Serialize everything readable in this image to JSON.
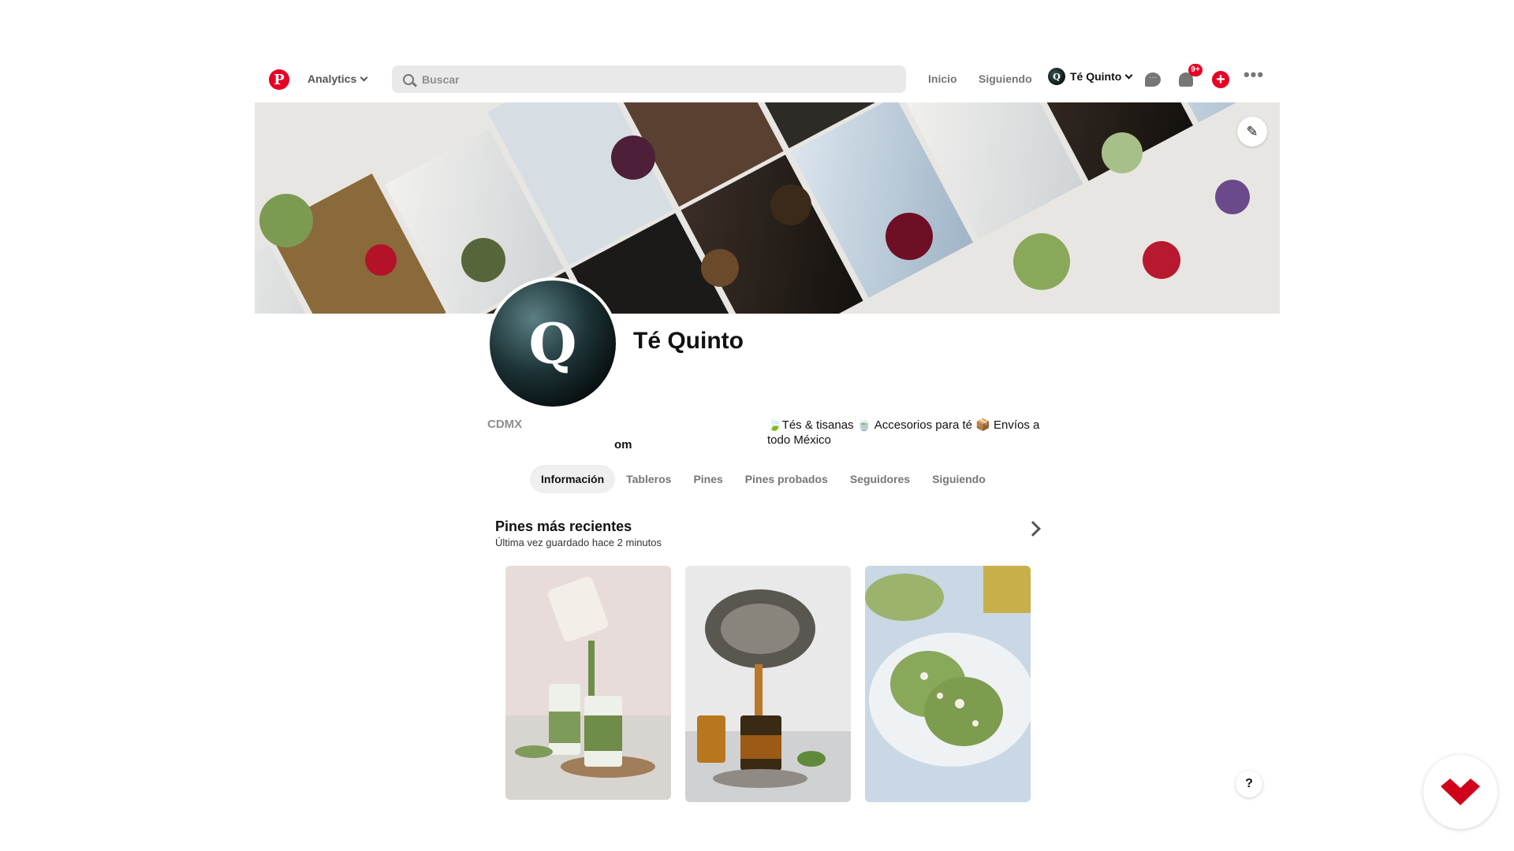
{
  "topbar": {
    "logo_letter": "P",
    "analytics_label": "Analytics",
    "search_placeholder": "Buscar",
    "nav_home": "Inicio",
    "nav_following": "Siguiendo",
    "account_name": "Té Quinto",
    "account_initial": "Q",
    "notifications_badge": "9+",
    "plus_symbol": "+",
    "more_symbol": "•••",
    "icons": [
      "pinterest-logo",
      "chevron-down-icon",
      "search-icon",
      "messages-icon",
      "bell-icon",
      "plus-icon",
      "more-icon"
    ]
  },
  "cover": {
    "edit_icon": "✎"
  },
  "profile": {
    "initial": "Q",
    "name": "Té Quinto",
    "location": "CDMX",
    "website_fragment": "om",
    "bio": "🍃Tés & tisanas 🍵 Accesorios para té 📦 Envíos a todo México"
  },
  "tabs": [
    {
      "label": "Información",
      "active": true
    },
    {
      "label": "Tableros",
      "active": false
    },
    {
      "label": "Pines",
      "active": false
    },
    {
      "label": "Pines probados",
      "active": false
    },
    {
      "label": "Seguidores",
      "active": false
    },
    {
      "label": "Siguiendo",
      "active": false
    }
  ],
  "recent": {
    "title": "Pines más recientes",
    "subtitle": "Última vez guardado hace 2 minutos"
  },
  "help_label": "?",
  "colors": {
    "brand_red": "#e60023",
    "tab_active_bg": "#efefef",
    "matcha_green": "#8aa85a"
  }
}
